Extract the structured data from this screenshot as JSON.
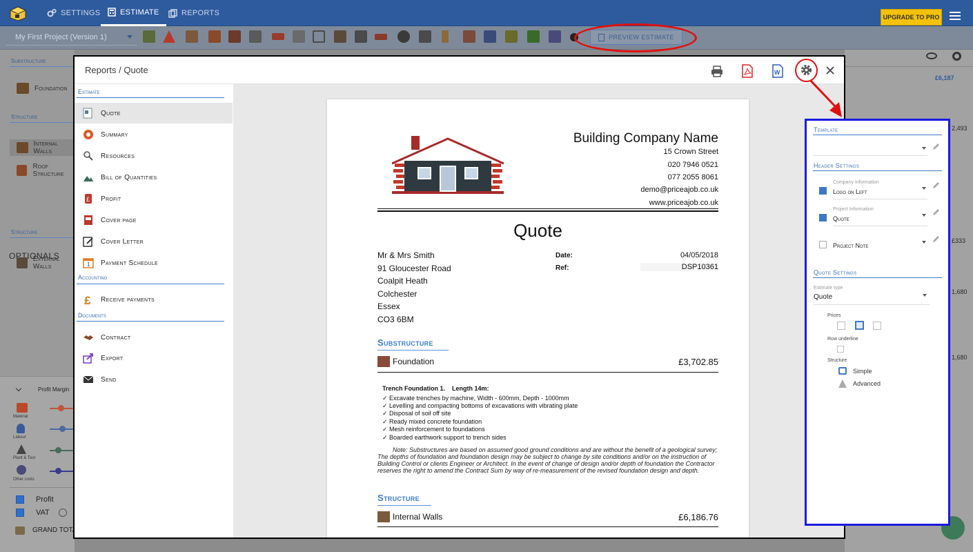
{
  "topbar": {
    "nav": [
      {
        "label": "SETTINGS",
        "icon": "gears-icon"
      },
      {
        "label": "ESTIMATE",
        "icon": "calculator-icon"
      },
      {
        "label": "REPORTS",
        "icon": "reports-icon"
      }
    ],
    "upgrade_label": "UPGRADE TO PRO"
  },
  "toolbar": {
    "project_select": "My First Project (Version 1)",
    "preview_label": "PREVIEW ESTIMATE"
  },
  "background": {
    "sections": [
      {
        "header": "Substructure",
        "items": [
          "Foundation"
        ]
      },
      {
        "header": "Structure",
        "items": [
          "Internal Walls",
          "Roof Structure"
        ]
      }
    ],
    "optionals_label": "OPTIONALS",
    "optionals_section": {
      "header": "Structure",
      "items": [
        "External Walls"
      ]
    },
    "profit_margin_label": "Profit Margin",
    "margin_rows": [
      "Material",
      "Labour",
      "Plant & Tool",
      "Other costs"
    ],
    "checks": [
      {
        "label": "Profit",
        "checked": true
      },
      {
        "label": "VAT",
        "checked": true
      }
    ],
    "grand_total_label": "GRAND TOTAL",
    "right_values": [
      "£6,187",
      "2,493",
      "£333",
      "1,680",
      "1,680"
    ]
  },
  "modal": {
    "title": "Reports / Quote",
    "header_icons": [
      "print-icon",
      "pdf-icon",
      "word-icon",
      "settings-gear-icon",
      "close-icon"
    ],
    "menu_sections": [
      {
        "header": "Estimate",
        "items": [
          {
            "label": "Quote",
            "icon": "quote-icon",
            "active": true
          },
          {
            "label": "Summary",
            "icon": "summary-icon"
          },
          {
            "label": "Resources",
            "icon": "resources-icon"
          },
          {
            "label": "Bill of Quantities",
            "icon": "bill-of-quantities-icon"
          },
          {
            "label": "Profit",
            "icon": "profit-icon"
          },
          {
            "label": "Cover page",
            "icon": "cover-page-icon"
          },
          {
            "label": "Cover Letter",
            "icon": "cover-letter-icon"
          },
          {
            "label": "Payment Schedule",
            "icon": "payment-schedule-icon"
          }
        ]
      },
      {
        "header": "Accounting",
        "items": [
          {
            "label": "Receive payments",
            "icon": "pound-icon"
          }
        ]
      },
      {
        "header": "Documents",
        "items": [
          {
            "label": "Contract",
            "icon": "handshake-icon"
          },
          {
            "label": "Export",
            "icon": "export-icon"
          },
          {
            "label": "Send",
            "icon": "envelope-icon"
          }
        ]
      }
    ]
  },
  "document": {
    "company_name": "Building Company Name",
    "company_lines": [
      "15 Crown Street",
      "020 7946 0521",
      "077 2055 8061",
      "demo@priceajob.co.uk",
      "www.priceajob.co.uk"
    ],
    "title": "Quote",
    "client_address": [
      "Mr & Mrs Smith",
      "91 Gloucester Road",
      "Coalpit Heath",
      "Colchester",
      "Essex",
      "CO3 6BM"
    ],
    "date_label": "Date:",
    "date_value": "04/05/2018",
    "ref_label": "Ref:",
    "ref_value": "DSP10361",
    "sections": [
      {
        "name": "Substructure",
        "items": [
          {
            "name": "Foundation",
            "amount": "£3,702.85",
            "details_title": "Trench Foundation 1.    Length 14m:",
            "bullets": [
              "✓ Excavate trenches by machine, Width - 600mm, Depth - 1000mm",
              "✓ Levelling and compacting bottoms of excavations with vibrating plate",
              "✓ Disposal of soil off site",
              "✓ Ready mixed concrete foundation",
              "✓ Mesh reinforcement to foundations",
              "✓ Boarded earthwork support to trench sides"
            ],
            "note": "Note: Substructures are based on assumed good ground conditions and are without the benefit of a geological survey; The depths of foundation and foundation design may be subject to change by site conditions and/or on the instruction of Building Control or clients Engineer or Architect. In the event of change of design and/or depth of foundation the Contractor reserves the right to amend the Contract Sum by way of re-measurement of the revised foundation design and depth."
          }
        ]
      },
      {
        "name": "Structure",
        "items": [
          {
            "name": "Internal Walls",
            "amount": "£6,186.76"
          }
        ]
      }
    ]
  },
  "settings_panel": {
    "template_label": "Template",
    "header_settings_label": "Header Settings",
    "company_info": {
      "sublabel": "Company Information",
      "value": "Logo on Left",
      "checked": true
    },
    "project_info": {
      "sublabel": "Project Information",
      "value": "Quote",
      "checked": true
    },
    "project_note": {
      "value": "Project Note",
      "checked": false
    },
    "quote_settings_label": "Quote Settings",
    "estimate_type_sublabel": "Estimate type",
    "estimate_type_value": "Quote",
    "prices_label": "Prices",
    "row_underline_label": "Row underline",
    "structure_label": "Structure",
    "structure_options": [
      "Simple",
      "Advanced"
    ]
  },
  "colors": {
    "brand_blue": "#2e5a9e",
    "accent_blue": "#3d78c8",
    "highlight_red": "#e01010",
    "panel_border": "#1a1ae0",
    "upgrade_yellow": "#f4c20d"
  }
}
